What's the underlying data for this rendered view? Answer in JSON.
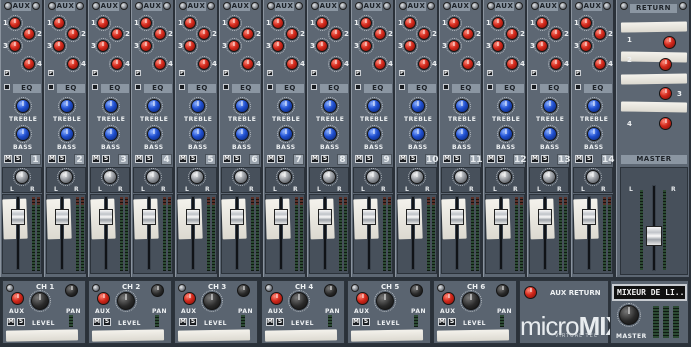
{
  "channel_strip": {
    "aux_header": "AUX",
    "aux_sends": [
      "1",
      "2",
      "3",
      "4"
    ],
    "pre_label": "P",
    "eq_header": "EQ",
    "treble_label": "TREBLE",
    "bass_label": "BASS",
    "mute_label": "M",
    "solo_label": "S",
    "left_label": "L",
    "right_label": "R",
    "channels": [
      "1",
      "2",
      "3",
      "4",
      "5",
      "6",
      "7",
      "8",
      "9",
      "10",
      "11",
      "12",
      "13",
      "14"
    ]
  },
  "return_section": {
    "header": "RETURN",
    "returns": [
      "1",
      "2",
      "3",
      "4"
    ],
    "master_header": "MASTER"
  },
  "bottom_channels": {
    "aux_label": "AUX",
    "level_label": "LEVEL",
    "pan_label": "PAN",
    "mute_label": "M",
    "solo_label": "S",
    "channels": [
      "CH 1",
      "CH 2",
      "CH 3",
      "CH 4",
      "CH 5",
      "CH 6"
    ]
  },
  "aux_return": {
    "label": "AUX RETURN"
  },
  "display": {
    "text": "MIXEUR DE LI..."
  },
  "brand": {
    "micro": "micro",
    "mix": "MIX",
    "subtitle": "VIRTUAL TEC"
  },
  "master_knob": {
    "label": "MASTER"
  },
  "colors": {
    "panel": "#5d6773",
    "accent_red": "#d2281b",
    "accent_blue": "#1f4fd1",
    "label_bar": "#8b96a2"
  },
  "icons": {
    "screw": "screw-icon",
    "pre": "pre-fader-icon",
    "eq": "eq-toggle-icon"
  }
}
